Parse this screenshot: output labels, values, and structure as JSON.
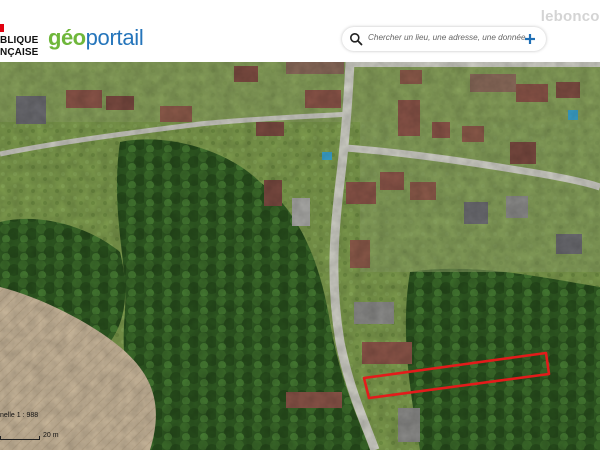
{
  "header": {
    "gov_logo_line1": "BLIQUE",
    "gov_logo_line2": "NÇAISE",
    "brand_geo": "géo",
    "brand_portail": "portail"
  },
  "search": {
    "placeholder": "Chercher un lieu, une adresse, une donnée",
    "add_label": "+"
  },
  "watermark": "leboncoi",
  "scale": {
    "ratio_text": "nelle 1 : 988",
    "bar_text": "20 m"
  },
  "colors": {
    "highlight": "#e31b1b",
    "brand_green": "#6fb73b",
    "brand_blue": "#2575bb",
    "gov_red": "#e1000f"
  },
  "icons": {
    "search": "search-icon",
    "add": "plus-icon"
  }
}
